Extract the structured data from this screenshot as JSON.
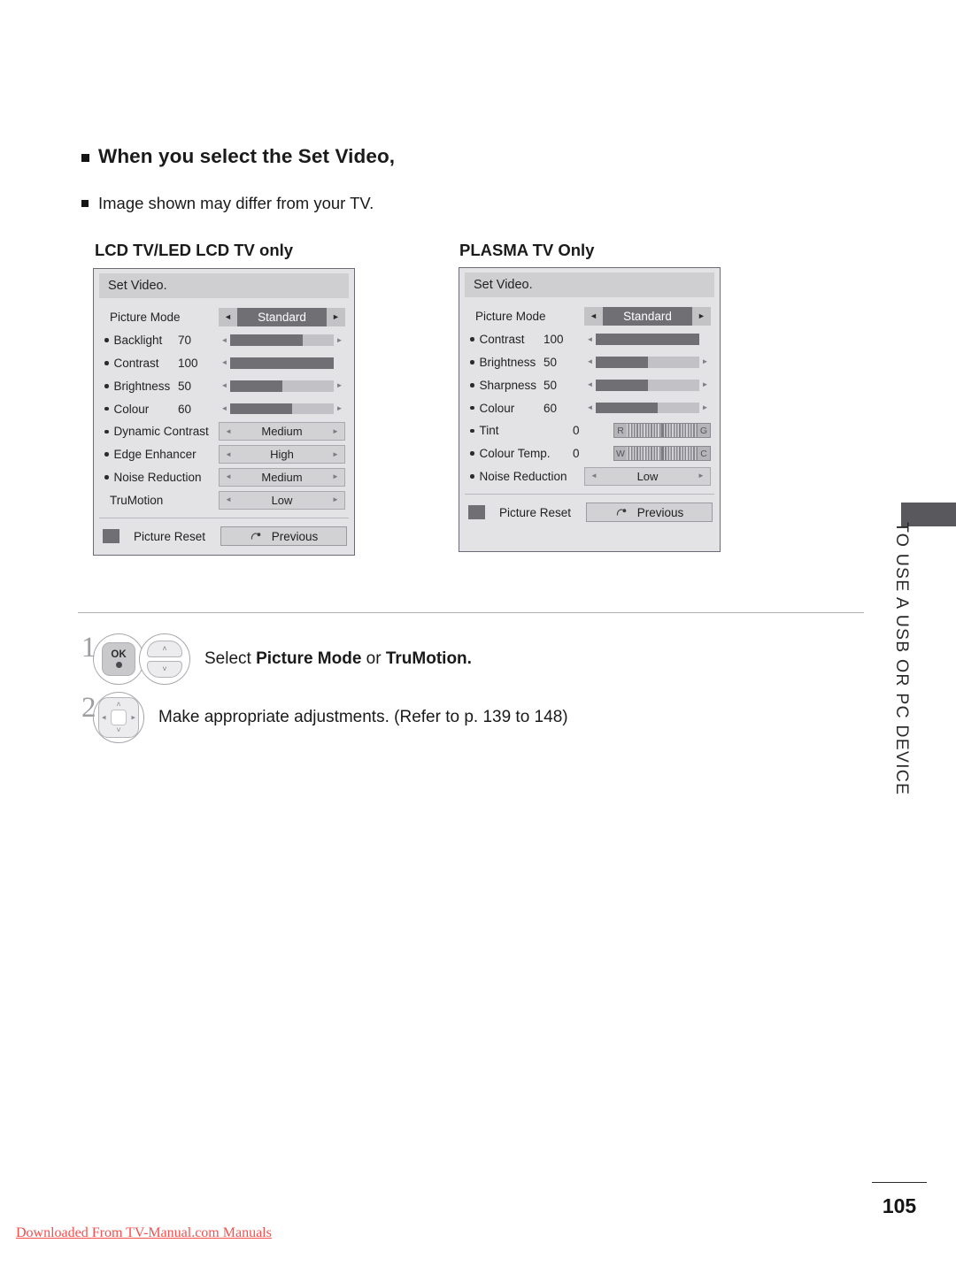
{
  "headings": {
    "main": "When you select the Set Video,",
    "sub": "Image shown may differ from your TV."
  },
  "panels": [
    {
      "title": "LCD TV/LED LCD TV only",
      "header": "Set Video.",
      "rows": [
        {
          "kind": "selector",
          "label": "Picture Mode",
          "bullet": false,
          "value": "",
          "option": "Standard",
          "left_arrow": "◄",
          "right_arrow": "►"
        },
        {
          "kind": "slider",
          "label": "Backlight",
          "bullet": true,
          "value": "70",
          "fill": 70,
          "show_right_arrow": true
        },
        {
          "kind": "slider",
          "label": "Contrast",
          "bullet": true,
          "value": "100",
          "fill": 100,
          "show_right_arrow": false
        },
        {
          "kind": "slider",
          "label": "Brightness",
          "bullet": true,
          "value": "50",
          "fill": 50,
          "show_right_arrow": true
        },
        {
          "kind": "slider",
          "label": "Colour",
          "bullet": true,
          "value": "60",
          "fill": 60,
          "show_right_arrow": true
        },
        {
          "kind": "option",
          "label": "Dynamic Contrast",
          "bullet": true,
          "value": "",
          "option": "Medium"
        },
        {
          "kind": "option",
          "label": "Edge Enhancer",
          "bullet": true,
          "value": "",
          "option": "High"
        },
        {
          "kind": "option",
          "label": "Noise Reduction",
          "bullet": true,
          "value": "",
          "option": "Medium"
        },
        {
          "kind": "option",
          "label": "TruMotion",
          "bullet": false,
          "value": "",
          "option": "Low"
        }
      ],
      "reset_label": "Picture Reset",
      "previous_label": "Previous"
    },
    {
      "title": "PLASMA TV Only",
      "header": "Set Video.",
      "rows": [
        {
          "kind": "selector",
          "label": "Picture Mode",
          "bullet": false,
          "value": "",
          "option": "Standard",
          "left_arrow": "◄",
          "right_arrow": "►"
        },
        {
          "kind": "slider",
          "label": "Contrast",
          "bullet": true,
          "value": "100",
          "fill": 100,
          "show_right_arrow": false
        },
        {
          "kind": "slider",
          "label": "Brightness",
          "bullet": true,
          "value": "50",
          "fill": 50,
          "show_right_arrow": true
        },
        {
          "kind": "slider",
          "label": "Sharpness",
          "bullet": true,
          "value": "50",
          "fill": 50,
          "show_right_arrow": true
        },
        {
          "kind": "slider",
          "label": "Colour",
          "bullet": true,
          "value": "60",
          "fill": 60,
          "show_right_arrow": true
        },
        {
          "kind": "gauge",
          "label": "Tint",
          "bullet": true,
          "value": "0",
          "left_cap": "R",
          "right_cap": "G"
        },
        {
          "kind": "gauge",
          "label": "Colour Temp.",
          "bullet": true,
          "value": "0",
          "left_cap": "W",
          "right_cap": "C"
        },
        {
          "kind": "option",
          "label": "Noise Reduction",
          "bullet": true,
          "value": "",
          "option": "Low"
        }
      ],
      "reset_label": "Picture Reset",
      "previous_label": "Previous"
    }
  ],
  "steps": [
    {
      "number": "1",
      "text_plain_1": "Select ",
      "text_bold_1": "Picture Mode",
      "text_plain_2": " or ",
      "text_bold_2": "TruMotion.",
      "ok_label": "OK"
    },
    {
      "number": "2",
      "text": "Make appropriate adjustments. (Refer to p. 139 to 148)"
    }
  ],
  "side_tab": {
    "text": "TO USE A USB OR PC DEVICE"
  },
  "footer": {
    "page_number": "105",
    "download_note": "Downloaded From TV-Manual.com Manuals"
  },
  "colors": {
    "osd_background": "#e3e3e5",
    "osd_header": "#cfcfd1",
    "slider_fill": "#6f6f74",
    "slider_track": "#c2c2c6",
    "selector_mid": "#6f6f74",
    "tab_mark": "#58585d",
    "download_note": "#f4504f"
  },
  "arrows": {
    "left": "◄",
    "right": "►",
    "small_left": "◂",
    "small_right": "▸",
    "up": "˄",
    "down": "˅"
  }
}
